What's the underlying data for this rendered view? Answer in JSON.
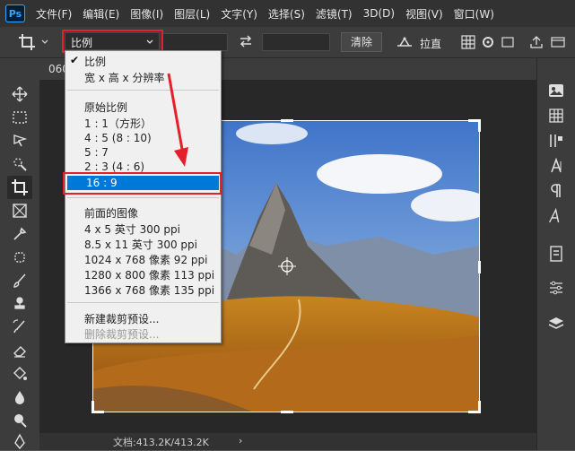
{
  "app": {
    "logo": "Ps"
  },
  "menubar": {
    "items": [
      "文件(F)",
      "编辑(E)",
      "图像(I)",
      "图层(L)",
      "文字(Y)",
      "选择(S)",
      "滤镜(T)",
      "3D(D)",
      "视图(V)",
      "窗口(W)"
    ]
  },
  "options": {
    "ratio_value": "比例",
    "clear_label": "清除",
    "straighten_label": "拉直"
  },
  "document": {
    "tab_label": "060"
  },
  "status": {
    "doc_info": "文档:413.2K/413.2K",
    "arrow": "›"
  },
  "dropdown": {
    "checked_item": "比例",
    "item_res": "宽 x 高 x 分辨率",
    "section_original": "原始比例",
    "ratios": [
      "1 : 1（方形）",
      "4 : 5 (8 : 10)",
      "5 : 7",
      "2 : 3 (4 : 6)"
    ],
    "highlighted": "16 : 9",
    "section_front": "前面的图像",
    "presets": [
      "4 x 5 英寸 300 ppi",
      "8.5 x 11 英寸 300 ppi",
      "1024 x 768 像素 92 ppi",
      "1280 x 800 像素 113 ppi",
      "1366 x 768 像素 135 ppi"
    ],
    "new_preset": "新建裁剪预设...",
    "delete_preset": "删除裁剪预设..."
  },
  "colors": {
    "highlight": "#0078d7",
    "annotation": "#e5202a",
    "chrome_dark": "#323232",
    "chrome_mid": "#3c3c3c",
    "canvas_bg": "#282828"
  },
  "icons": {
    "toolbar": [
      "move-icon",
      "marquee-icon",
      "lasso-icon",
      "quick-select-icon",
      "crop-icon",
      "frame-icon",
      "eyedropper-icon",
      "healing-brush-icon",
      "brush-icon",
      "stamp-icon",
      "history-brush-icon",
      "eraser-icon",
      "paint-bucket-icon",
      "blur-icon",
      "dodge-icon",
      "pen-icon"
    ],
    "right_panel": [
      "image-panel-icon",
      "grid-panel-icon",
      "adjust-panel-icon",
      "character-icon",
      "paragraph-icon",
      "glyphs-icon",
      "properties-icon",
      "sliders-icon",
      "layers-icon"
    ]
  }
}
